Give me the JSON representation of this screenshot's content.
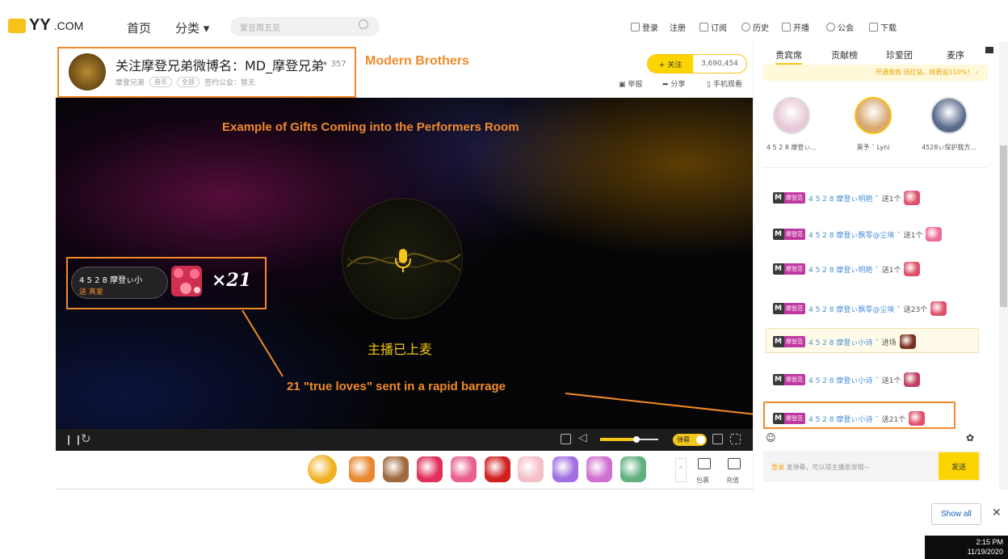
{
  "topbar": {
    "logo": "YY",
    "logo_suffix": ".COM",
    "nav": [
      "首页",
      "分类 ▾"
    ],
    "search_placeholder": "爱豆周五见",
    "links": [
      "登录",
      "注册",
      "订阅",
      "历史",
      "开播",
      "公会",
      "下载"
    ]
  },
  "streamer": {
    "name": "关注摩登兄弟微博名：MD_摩登兄弟",
    "fans": "357",
    "sub_name": "摩登兄弟",
    "tags": [
      "音乐",
      "全部"
    ],
    "guild": "签约公会：暂无",
    "follow_label": "+ 关注",
    "follow_count": "3,690,454",
    "actions": [
      "举报",
      "分享",
      "手机观看"
    ]
  },
  "annotation": {
    "modern": "Modern Brothers",
    "example": "Example of Gifts Coming into the Performers Room",
    "barrage": "21 \"true loves\" sent in a rapid barrage"
  },
  "video": {
    "live_text": "主播已上麦",
    "gift_user": "4 5 2 8 摩登ぃ小",
    "gift_text": "送 真爱",
    "gift_count": "×21"
  },
  "controls": {
    "danmu": "弹幕",
    "volume_level": 0.62
  },
  "giftbar": {
    "items": [
      "#f0b020",
      "#e88830",
      "#a06a40",
      "#e0305a",
      "#e86090",
      "#d02020",
      "#f4c0c8",
      "#a070e0",
      "#d070d0",
      "#60b080"
    ],
    "bag": "包裹",
    "recharge": "充值"
  },
  "rpanel": {
    "tabs": [
      "贵宾席",
      "贡献榜",
      "珍爱团",
      "麦序"
    ],
    "vip_text": "开通贵族 送红钻，续费返110%！ ›",
    "vips": [
      {
        "name": "4 5 2 8 摩登ぃ...",
        "color": "#e8c8d8"
      },
      {
        "name": "莫予 ˇ Lyni",
        "color": "#d8a870"
      },
      {
        "name": "4528ぃ保护我方...",
        "color": "#5a6a8a"
      }
    ],
    "chat": [
      {
        "badge": "摩登范",
        "user": "4 5 2 8 摩登ぃ明艳 ˇ",
        "action": "送1个",
        "gift": "#e0506a"
      },
      {
        "badge": "摩登范",
        "user": "4 5 2 8 摩登ぃ飘零@尘埃 ˇ",
        "action": "送1个",
        "gift": "#f06a9a"
      },
      {
        "badge": "摩登范",
        "user": "4 5 2 8 摩登ぃ明艳 ˇ",
        "action": "送1个",
        "gift": "#e0506a"
      },
      {
        "badge": "摩登范",
        "user": "4 5 2 8 摩登ぃ飘零@尘埃 ˇ",
        "action": "送23个",
        "gift": "#e0506a"
      },
      {
        "badge": "摩登范",
        "user": "4 5 2 8 摩登ぃ小诗 ˇ",
        "action": "进场",
        "gift": "#7a3020"
      },
      {
        "badge": "摩登范",
        "user": "4 5 2 8 摩登ぃ小诗 ˇ",
        "action": "送1个",
        "gift": "#c04060"
      },
      {
        "badge": "摩登范",
        "user": "4 5 2 8 摩登ぃ小诗 ˇ",
        "action": "送21个",
        "gift": "#e0506a"
      }
    ],
    "input_placeholder": "发弹幕，可以得主播恩宠哦~",
    "input_login": "登录",
    "send": "发送"
  },
  "taskbar": {
    "show_all": "Show all",
    "time": "2:15 PM",
    "date": "11/19/2020"
  }
}
